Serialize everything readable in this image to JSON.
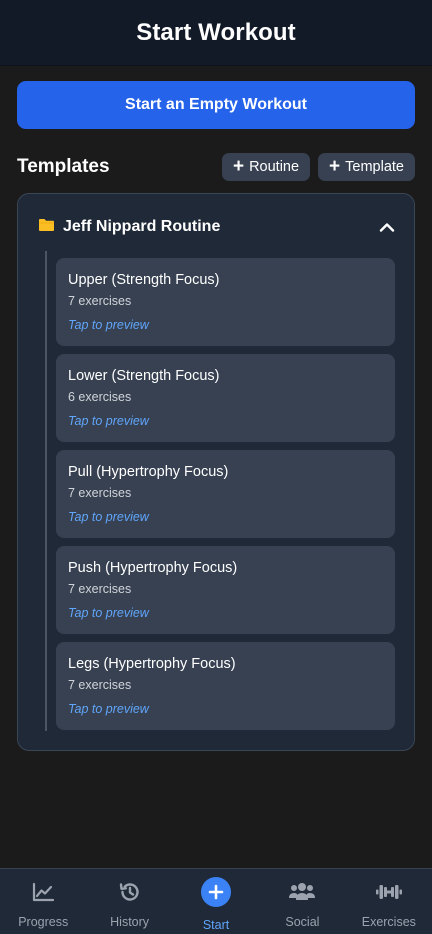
{
  "header": {
    "title": "Start Workout"
  },
  "start_button": {
    "label": "Start an Empty Workout"
  },
  "templates_section": {
    "title": "Templates",
    "add_routine_label": "Routine",
    "add_template_label": "Template"
  },
  "folder": {
    "name": "Jeff Nippard Routine",
    "folder_icon": "folder-icon",
    "toggle_icon": "chevron-up-icon",
    "templates": [
      {
        "name": "Upper (Strength Focus)",
        "count": "7 exercises",
        "hint": "Tap to preview"
      },
      {
        "name": "Lower (Strength Focus)",
        "count": "6 exercises",
        "hint": "Tap to preview"
      },
      {
        "name": "Pull (Hypertrophy Focus)",
        "count": "7 exercises",
        "hint": "Tap to preview"
      },
      {
        "name": "Push (Hypertrophy Focus)",
        "count": "7 exercises",
        "hint": "Tap to preview"
      },
      {
        "name": "Legs (Hypertrophy Focus)",
        "count": "7 exercises",
        "hint": "Tap to preview"
      }
    ]
  },
  "nav": {
    "items": [
      {
        "label": "Progress",
        "icon": "chart-line-icon"
      },
      {
        "label": "History",
        "icon": "history-icon"
      },
      {
        "label": "Start",
        "icon": "plus-icon",
        "active": true
      },
      {
        "label": "Social",
        "icon": "users-icon"
      },
      {
        "label": "Exercises",
        "icon": "dumbbell-icon"
      }
    ]
  },
  "colors": {
    "primary": "#2563eb",
    "accent_text": "#60a5fa",
    "folder": "#fbbf24",
    "background": "#1b1b1c",
    "card": "#1f2937",
    "item": "#374151"
  }
}
